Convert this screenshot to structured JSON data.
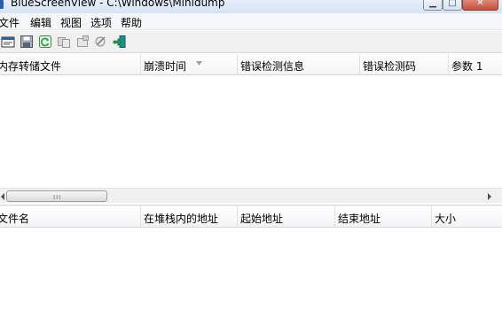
{
  "window": {
    "title": "BlueScreenView  -  C:\\Windows\\Minidump"
  },
  "menu": {
    "items": [
      {
        "label": "文件"
      },
      {
        "label": "编辑"
      },
      {
        "label": "视图"
      },
      {
        "label": "选项"
      },
      {
        "label": "帮助"
      }
    ]
  },
  "toolbar": {
    "icons": [
      "properties-icon",
      "save-icon",
      "refresh-icon",
      "copy-icon",
      "html-report-icon",
      "advanced-options-icon",
      "exit-icon"
    ]
  },
  "top_table": {
    "columns": [
      {
        "label": "内存转储文件"
      },
      {
        "label": "崩溃时间"
      },
      {
        "label": "错误检测信息"
      },
      {
        "label": "错误检测码"
      },
      {
        "label": "参数 1"
      }
    ],
    "sort_icon": "sort-descending-icon",
    "rows": []
  },
  "bottom_table": {
    "columns": [
      {
        "label": "文件名"
      },
      {
        "label": "在堆栈内的地址"
      },
      {
        "label": "起始地址"
      },
      {
        "label": "结束地址"
      },
      {
        "label": "大小"
      }
    ],
    "rows": []
  },
  "scrollbar": {
    "grip": "III"
  }
}
